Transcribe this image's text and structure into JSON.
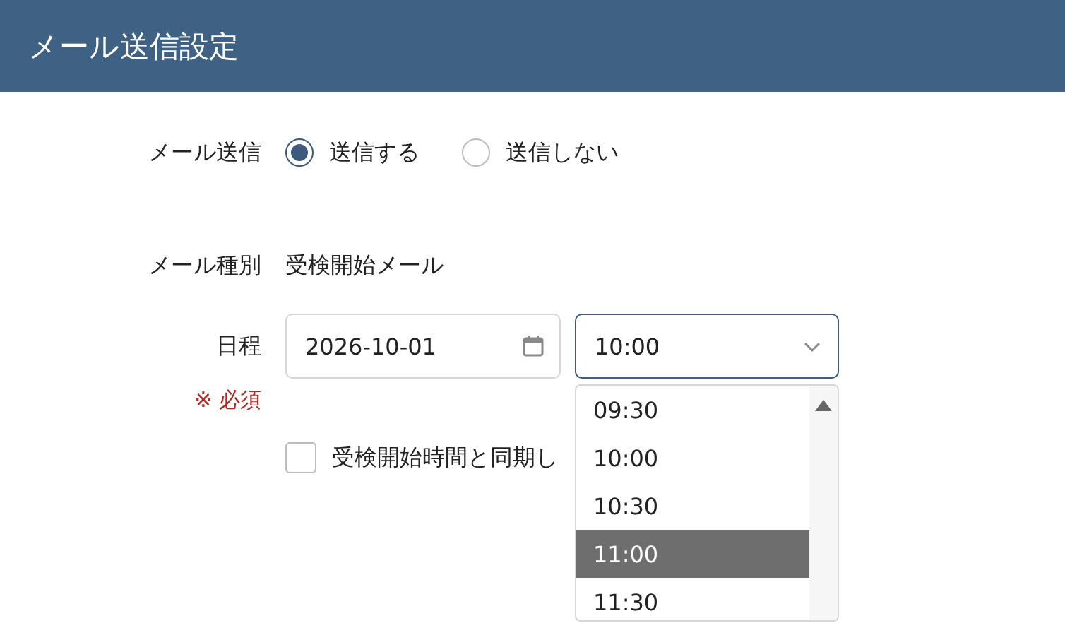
{
  "header": {
    "title": "メール送信設定"
  },
  "send_mail": {
    "label": "メール送信",
    "options": [
      {
        "label": "送信する",
        "selected": true
      },
      {
        "label": "送信しない",
        "selected": false
      }
    ]
  },
  "mail_type": {
    "label": "メール種別",
    "value": "受検開始メール"
  },
  "schedule": {
    "label": "日程",
    "required": "※ 必須",
    "date": "2026-10-01",
    "time": "10:00",
    "time_options": [
      {
        "label": "09:30",
        "selected": false
      },
      {
        "label": "10:00",
        "selected": false
      },
      {
        "label": "10:30",
        "selected": false
      },
      {
        "label": "11:00",
        "selected": true
      },
      {
        "label": "11:30",
        "selected": false
      }
    ],
    "sync": {
      "label": "受検開始時間と同期し",
      "checked": false
    }
  }
}
